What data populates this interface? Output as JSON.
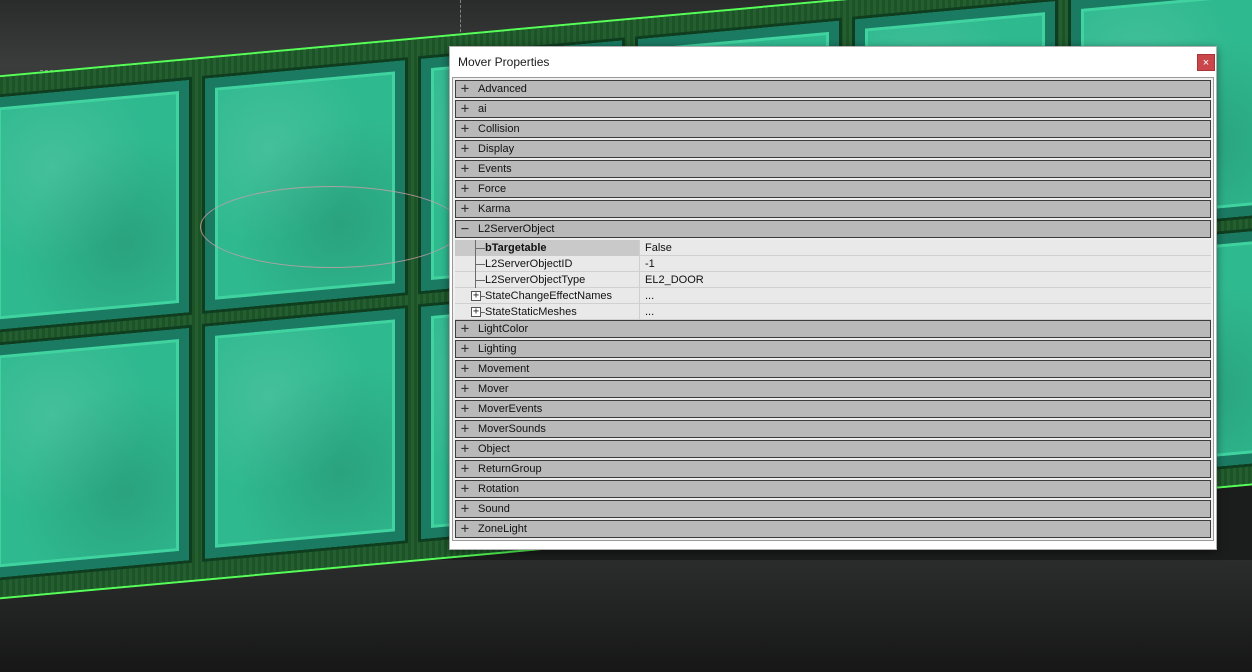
{
  "window": {
    "title": "Mover Properties",
    "close_glyph": "×"
  },
  "categories_before": [
    {
      "label": "Advanced",
      "state": "collapsed"
    },
    {
      "label": "ai",
      "state": "collapsed"
    },
    {
      "label": "Collision",
      "state": "collapsed"
    },
    {
      "label": "Display",
      "state": "collapsed"
    },
    {
      "label": "Events",
      "state": "collapsed"
    },
    {
      "label": "Force",
      "state": "collapsed"
    },
    {
      "label": "Karma",
      "state": "collapsed"
    }
  ],
  "expanded_category": {
    "label": "L2ServerObject",
    "state": "expanded",
    "properties": [
      {
        "name": "bTargetable",
        "value": "False",
        "selected": true,
        "expandable": false
      },
      {
        "name": "L2ServerObjectID",
        "value": "-1",
        "selected": false,
        "expandable": false
      },
      {
        "name": "L2ServerObjectType",
        "value": "EL2_DOOR",
        "selected": false,
        "expandable": false
      },
      {
        "name": "StateChangeEffectNames",
        "value": "...",
        "selected": false,
        "expandable": true
      },
      {
        "name": "StateStaticMeshes",
        "value": "...",
        "selected": false,
        "expandable": true
      }
    ]
  },
  "categories_after": [
    {
      "label": "LightColor",
      "state": "collapsed"
    },
    {
      "label": "Lighting",
      "state": "collapsed"
    },
    {
      "label": "Movement",
      "state": "collapsed"
    },
    {
      "label": "Mover",
      "state": "collapsed"
    },
    {
      "label": "MoverEvents",
      "state": "collapsed"
    },
    {
      "label": "MoverSounds",
      "state": "collapsed"
    },
    {
      "label": "Object",
      "state": "collapsed"
    },
    {
      "label": "ReturnGroup",
      "state": "collapsed"
    },
    {
      "label": "Rotation",
      "state": "collapsed"
    },
    {
      "label": "Sound",
      "state": "collapsed"
    },
    {
      "label": "ZoneLight",
      "state": "collapsed"
    }
  ],
  "icons": {
    "collapsed": "+",
    "expanded": "−",
    "sub_expander": "+"
  }
}
